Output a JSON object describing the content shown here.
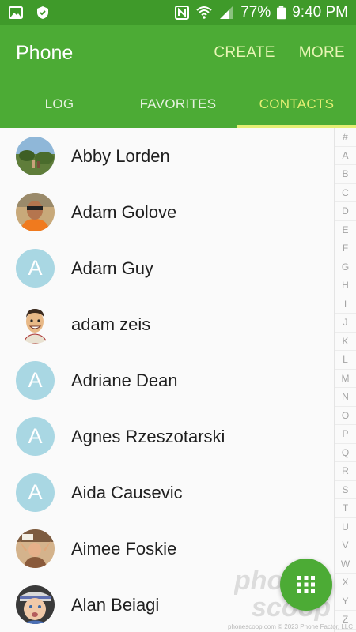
{
  "status_bar": {
    "battery": "77%",
    "time": "9:40 PM",
    "icons": [
      "gallery-icon",
      "shield-icon",
      "nfc-icon",
      "wifi-icon",
      "signal-icon",
      "battery-icon"
    ]
  },
  "app_bar": {
    "title": "Phone",
    "create_label": "CREATE",
    "more_label": "MORE"
  },
  "tabs": [
    {
      "label": "LOG",
      "active": false
    },
    {
      "label": "FAVORITES",
      "active": false
    },
    {
      "label": "CONTACTS",
      "active": true
    }
  ],
  "contacts": [
    {
      "name": "Abby Lorden",
      "avatar": "photo-landscape"
    },
    {
      "name": "Adam Golove",
      "avatar": "photo-person-orange"
    },
    {
      "name": "Adam Guy",
      "avatar": "letter",
      "letter": "A"
    },
    {
      "name": "adam zeis",
      "avatar": "cartoon"
    },
    {
      "name": "Adriane Dean",
      "avatar": "letter",
      "letter": "A"
    },
    {
      "name": "Agnes Rzeszotarski",
      "avatar": "letter",
      "letter": "A"
    },
    {
      "name": "Aida Causevic",
      "avatar": "letter",
      "letter": "A"
    },
    {
      "name": "Aimee Foskie",
      "avatar": "photo-person-hands"
    },
    {
      "name": "Alan Beiagi",
      "avatar": "photo-child"
    }
  ],
  "index_letters": [
    "#",
    "A",
    "B",
    "C",
    "D",
    "E",
    "F",
    "G",
    "H",
    "I",
    "J",
    "K",
    "L",
    "M",
    "N",
    "O",
    "P",
    "Q",
    "R",
    "S",
    "T",
    "U",
    "V",
    "W",
    "X",
    "Y",
    "Z"
  ],
  "fab": {
    "icon": "dialpad-icon"
  },
  "watermark": {
    "logo": "phonescoop",
    "credit": "phonescoop.com  © 2023 Phone Factor, LLC"
  },
  "colors": {
    "status_bar": "#3f9a2a",
    "app_bar": "#4cab35",
    "tab_active": "#e5ef74",
    "avatar_letter_bg": "#a9d7e3"
  }
}
